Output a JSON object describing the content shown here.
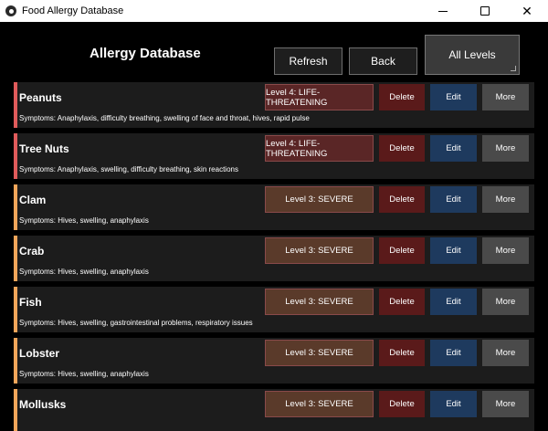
{
  "window": {
    "title": "Food Allergy Database"
  },
  "header": {
    "title": "Allergy Database",
    "refresh_label": "Refresh",
    "back_label": "Back",
    "levels_label": "All Levels"
  },
  "row_buttons": {
    "delete": "Delete",
    "edit": "Edit",
    "more": "More"
  },
  "colors": {
    "level4_bar": "#e05b5b",
    "level4_button": "#5a2626",
    "level3_bar": "#f2a65a",
    "level3_button": "#5a3a2a"
  },
  "allergies": [
    {
      "name": "Peanuts",
      "level": "Level 4: LIFE-THREATENING",
      "severity": 4,
      "symptoms": "Symptoms: Anaphylaxis, difficulty breathing, swelling of face and throat, hives, rapid pulse"
    },
    {
      "name": "Tree Nuts",
      "level": "Level 4: LIFE-THREATENING",
      "severity": 4,
      "symptoms": "Symptoms: Anaphylaxis, swelling, difficulty breathing, skin reactions"
    },
    {
      "name": "Clam",
      "level": "Level 3: SEVERE",
      "severity": 3,
      "symptoms": "Symptoms: Hives, swelling, anaphylaxis"
    },
    {
      "name": "Crab",
      "level": "Level 3: SEVERE",
      "severity": 3,
      "symptoms": "Symptoms: Hives, swelling, anaphylaxis"
    },
    {
      "name": "Fish",
      "level": "Level 3: SEVERE",
      "severity": 3,
      "symptoms": "Symptoms: Hives, swelling, gastrointestinal problems, respiratory issues"
    },
    {
      "name": "Lobster",
      "level": "Level 3: SEVERE",
      "severity": 3,
      "symptoms": "Symptoms: Hives, swelling, anaphylaxis"
    },
    {
      "name": "Mollusks",
      "level": "Level 3: SEVERE",
      "severity": 3,
      "symptoms": ""
    }
  ]
}
